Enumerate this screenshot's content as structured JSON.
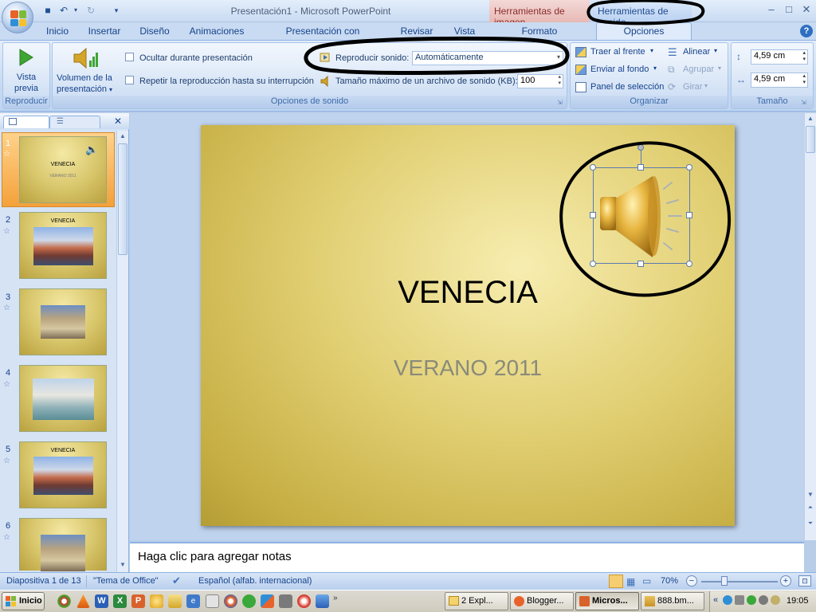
{
  "window": {
    "title": "Presentación1 - Microsoft PowerPoint",
    "context_tabs": {
      "image_tools": "Herramientas de imagen",
      "sound_tools": "Herramientas de sonido"
    }
  },
  "ribbon": {
    "tabs": [
      "Inicio",
      "Insertar",
      "Diseño",
      "Animaciones",
      "Presentación con diapositivas",
      "Revisar",
      "Vista",
      "Formato",
      "Opciones"
    ],
    "active_tab": "Opciones",
    "reproducir": {
      "preview_label_1": "Vista",
      "preview_label_2": "previa",
      "group_label": "Reproducir"
    },
    "sound_options": {
      "volume_label_1": "Volumen de la",
      "volume_label_2": "presentación",
      "hide_label": "Ocultar durante presentación",
      "loop_label": "Repetir la reproducción hasta su interrupción",
      "play_sound_label": "Reproducir sonido:",
      "play_sound_value": "Automáticamente",
      "max_size_label": "Tamaño máximo de un archivo de sonido (KB):",
      "max_size_value": "100",
      "group_label": "Opciones de sonido"
    },
    "arrange": {
      "bring_front": "Traer al frente",
      "send_back": "Enviar al fondo",
      "selection_pane": "Panel de selección",
      "align": "Alinear",
      "group": "Agrupar",
      "rotate": "Girar",
      "group_label": "Organizar"
    },
    "size": {
      "height": "4,59 cm",
      "width": "4,59 cm",
      "group_label": "Tamaño"
    }
  },
  "slides": [
    {
      "num": "1",
      "title": "VENECIA",
      "subtitle": "VERANO 2011"
    },
    {
      "num": "2",
      "title": "VENECIA"
    },
    {
      "num": "3"
    },
    {
      "num": "4"
    },
    {
      "num": "5",
      "title": "VENECIA"
    },
    {
      "num": "6"
    }
  ],
  "current_slide": {
    "title": "VENECIA",
    "subtitle": "VERANO 2011"
  },
  "notes_placeholder": "Haga clic para agregar notas",
  "status": {
    "slide_info": "Diapositiva 1 de 13",
    "theme": "\"Tema de Office\"",
    "language": "Español (alfab. internacional)",
    "zoom": "70%"
  },
  "taskbar": {
    "start": "Inicio",
    "items": [
      "2 Expl...",
      "Blogger...",
      "Micros...",
      "888.bm..."
    ],
    "clock": "19:05"
  },
  "colors": {
    "accent": "#15428b",
    "slide_gold": "#d8c66b",
    "annotation": "#000000"
  }
}
